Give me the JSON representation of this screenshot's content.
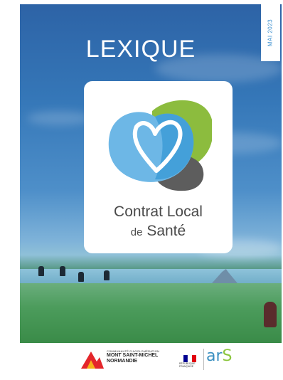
{
  "cover": {
    "title": "LEXIQUE",
    "date": "MAI 2023"
  },
  "logo": {
    "line1": "Contrat Local",
    "line2_prefix": "de",
    "line2_main": "Santé",
    "colors": {
      "blue_light": "#6db7e6",
      "blue_mid": "#3a9ad6",
      "green": "#8cbc3e",
      "grey": "#5d5d5d"
    }
  },
  "footer": {
    "cam": {
      "line1": "COMMUNAUTÉ D'AGGLOMÉRATION",
      "line2": "MONT SAINT-MICHEL",
      "line3": "NORMANDIE"
    },
    "republique": "RÉPUBLIQUE FRANÇAISE",
    "ars": {
      "part1": "ar",
      "part2": "S"
    }
  }
}
